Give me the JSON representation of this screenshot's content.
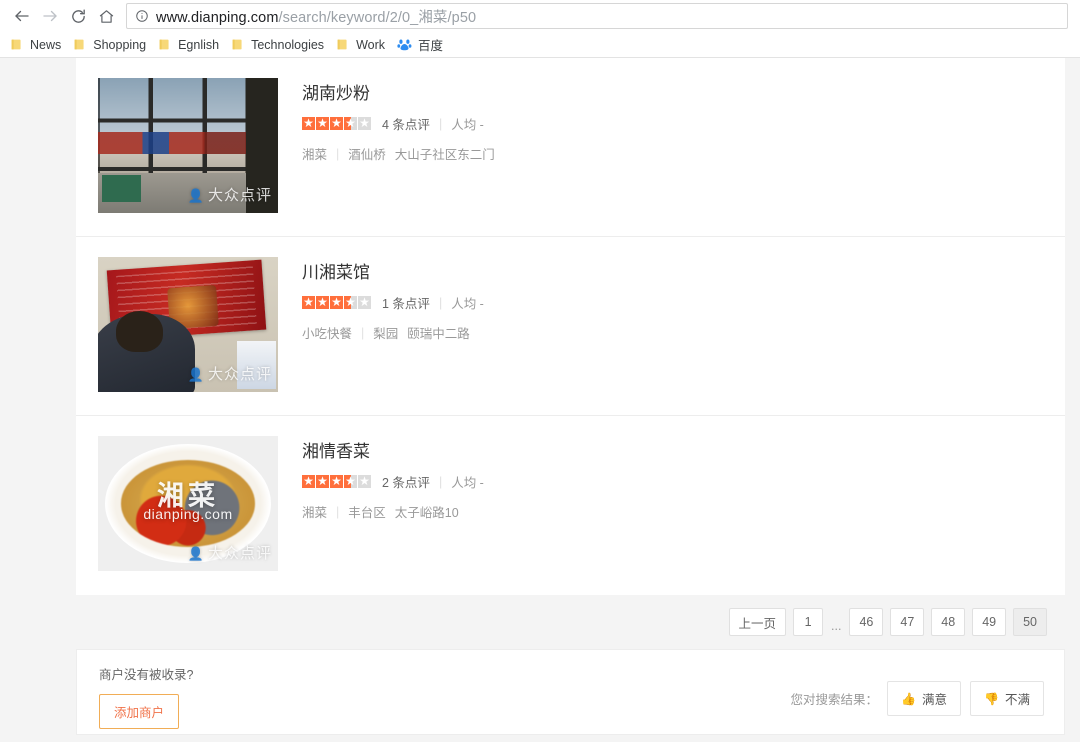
{
  "browser": {
    "back_label": "back",
    "forward_label": "forward",
    "reload_label": "reload",
    "home_label": "home",
    "url_host": "www.dianping.com",
    "url_path": "/search/keyword/2/0_湘菜/p50",
    "bookmarks": [
      {
        "label": "News",
        "icon": "folder-icon"
      },
      {
        "label": "Shopping",
        "icon": "folder-icon"
      },
      {
        "label": "Egnlish",
        "icon": "folder-icon"
      },
      {
        "label": "Technologies",
        "icon": "folder-icon"
      },
      {
        "label": "Work",
        "icon": "folder-icon"
      },
      {
        "label": "百度",
        "icon": "baidu-icon"
      }
    ]
  },
  "results": [
    {
      "name": "湖南炒粉",
      "stars": 3.5,
      "reviews": "4 条点评",
      "avg_price": "人均 -",
      "category": "湘菜",
      "region": "酒仙桥",
      "address": "大山子社区东二门",
      "watermark": "大众点评"
    },
    {
      "name": "川湘菜馆",
      "stars": 3.5,
      "reviews": "1 条点评",
      "avg_price": "人均 -",
      "category": "小吃快餐",
      "region": "梨园",
      "address": "颐瑞中二路",
      "watermark": "大众点评"
    },
    {
      "name": "湘情香菜",
      "stars": 3.5,
      "reviews": "2 条点评",
      "avg_price": "人均 -",
      "category": "湘菜",
      "region": "丰台区",
      "address": "太子峪路10",
      "watermark": "大众点评",
      "image_brand": "湘菜",
      "image_brand_sub": "dianping.com"
    }
  ],
  "pagination": {
    "prev_label": "上一页",
    "ellipsis": "...",
    "pages": [
      "1",
      "46",
      "47",
      "48",
      "49",
      "50"
    ],
    "current": "50"
  },
  "footer": {
    "question": "商户没有被收录?",
    "add_shop_label": "添加商户",
    "feedback_label": "您对搜索结果：",
    "satisfied_label": "满意",
    "unsatisfied_label": "不满"
  },
  "colors": {
    "star_fill": "#ff6f3c",
    "star_empty": "#dcdcdc",
    "accent_orange": "#f0734a",
    "page_bg": "#f4f4f4"
  }
}
